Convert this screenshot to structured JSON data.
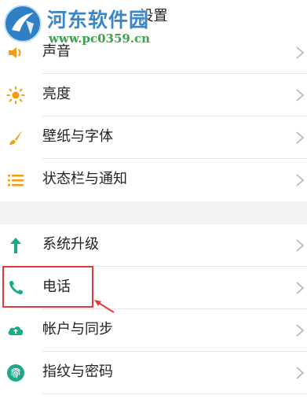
{
  "header": {
    "title": "设置"
  },
  "watermark": {
    "brand": "河东软件园",
    "url": "www.pc0359.cn"
  },
  "sections": [
    {
      "items": [
        {
          "label": "声音",
          "icon": "speaker-icon",
          "color": "#f39c12"
        },
        {
          "label": "亮度",
          "icon": "sun-icon",
          "color": "#f39c12"
        },
        {
          "label": "壁纸与字体",
          "icon": "brush-icon",
          "color": "#f39c12"
        },
        {
          "label": "状态栏与通知",
          "icon": "list-icon",
          "color": "#f39c12"
        }
      ]
    },
    {
      "items": [
        {
          "label": "系统升级",
          "icon": "arrow-up-icon",
          "color": "#1aaa8a"
        },
        {
          "label": "电话",
          "icon": "phone-icon",
          "color": "#1aaa8a",
          "highlighted": true
        },
        {
          "label": "帐户与同步",
          "icon": "cloud-sync-icon",
          "color": "#1aaa8a"
        },
        {
          "label": "指纹与密码",
          "icon": "fingerprint-icon",
          "color": "#1aaa8a"
        }
      ]
    }
  ],
  "annotation": {
    "highlight_color": "#e13b3b"
  }
}
